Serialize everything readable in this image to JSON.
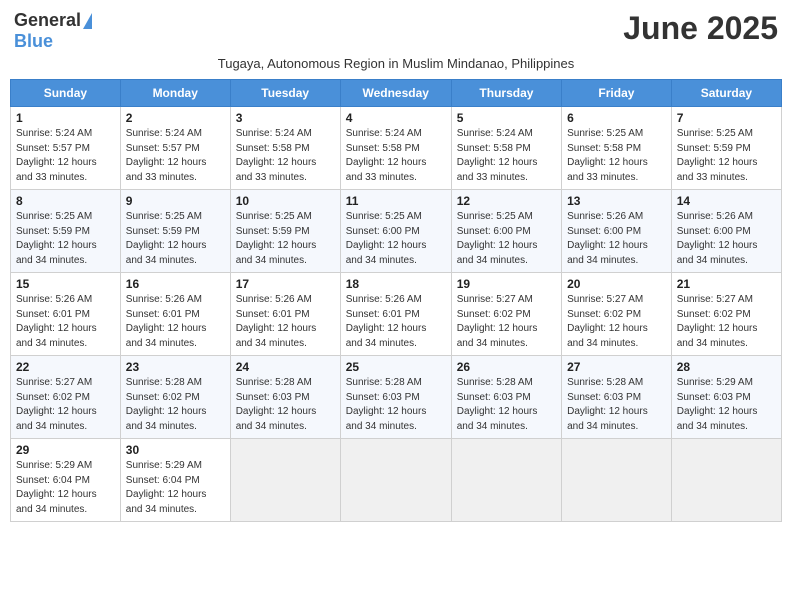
{
  "logo": {
    "general": "General",
    "blue": "Blue"
  },
  "title": "June 2025",
  "subtitle": "Tugaya, Autonomous Region in Muslim Mindanao, Philippines",
  "days_of_week": [
    "Sunday",
    "Monday",
    "Tuesday",
    "Wednesday",
    "Thursday",
    "Friday",
    "Saturday"
  ],
  "weeks": [
    [
      {
        "day": "1",
        "info": "Sunrise: 5:24 AM\nSunset: 5:57 PM\nDaylight: 12 hours\nand 33 minutes."
      },
      {
        "day": "2",
        "info": "Sunrise: 5:24 AM\nSunset: 5:57 PM\nDaylight: 12 hours\nand 33 minutes."
      },
      {
        "day": "3",
        "info": "Sunrise: 5:24 AM\nSunset: 5:58 PM\nDaylight: 12 hours\nand 33 minutes."
      },
      {
        "day": "4",
        "info": "Sunrise: 5:24 AM\nSunset: 5:58 PM\nDaylight: 12 hours\nand 33 minutes."
      },
      {
        "day": "5",
        "info": "Sunrise: 5:24 AM\nSunset: 5:58 PM\nDaylight: 12 hours\nand 33 minutes."
      },
      {
        "day": "6",
        "info": "Sunrise: 5:25 AM\nSunset: 5:58 PM\nDaylight: 12 hours\nand 33 minutes."
      },
      {
        "day": "7",
        "info": "Sunrise: 5:25 AM\nSunset: 5:59 PM\nDaylight: 12 hours\nand 33 minutes."
      }
    ],
    [
      {
        "day": "8",
        "info": "Sunrise: 5:25 AM\nSunset: 5:59 PM\nDaylight: 12 hours\nand 34 minutes."
      },
      {
        "day": "9",
        "info": "Sunrise: 5:25 AM\nSunset: 5:59 PM\nDaylight: 12 hours\nand 34 minutes."
      },
      {
        "day": "10",
        "info": "Sunrise: 5:25 AM\nSunset: 5:59 PM\nDaylight: 12 hours\nand 34 minutes."
      },
      {
        "day": "11",
        "info": "Sunrise: 5:25 AM\nSunset: 6:00 PM\nDaylight: 12 hours\nand 34 minutes."
      },
      {
        "day": "12",
        "info": "Sunrise: 5:25 AM\nSunset: 6:00 PM\nDaylight: 12 hours\nand 34 minutes."
      },
      {
        "day": "13",
        "info": "Sunrise: 5:26 AM\nSunset: 6:00 PM\nDaylight: 12 hours\nand 34 minutes."
      },
      {
        "day": "14",
        "info": "Sunrise: 5:26 AM\nSunset: 6:00 PM\nDaylight: 12 hours\nand 34 minutes."
      }
    ],
    [
      {
        "day": "15",
        "info": "Sunrise: 5:26 AM\nSunset: 6:01 PM\nDaylight: 12 hours\nand 34 minutes."
      },
      {
        "day": "16",
        "info": "Sunrise: 5:26 AM\nSunset: 6:01 PM\nDaylight: 12 hours\nand 34 minutes."
      },
      {
        "day": "17",
        "info": "Sunrise: 5:26 AM\nSunset: 6:01 PM\nDaylight: 12 hours\nand 34 minutes."
      },
      {
        "day": "18",
        "info": "Sunrise: 5:26 AM\nSunset: 6:01 PM\nDaylight: 12 hours\nand 34 minutes."
      },
      {
        "day": "19",
        "info": "Sunrise: 5:27 AM\nSunset: 6:02 PM\nDaylight: 12 hours\nand 34 minutes."
      },
      {
        "day": "20",
        "info": "Sunrise: 5:27 AM\nSunset: 6:02 PM\nDaylight: 12 hours\nand 34 minutes."
      },
      {
        "day": "21",
        "info": "Sunrise: 5:27 AM\nSunset: 6:02 PM\nDaylight: 12 hours\nand 34 minutes."
      }
    ],
    [
      {
        "day": "22",
        "info": "Sunrise: 5:27 AM\nSunset: 6:02 PM\nDaylight: 12 hours\nand 34 minutes."
      },
      {
        "day": "23",
        "info": "Sunrise: 5:28 AM\nSunset: 6:02 PM\nDaylight: 12 hours\nand 34 minutes."
      },
      {
        "day": "24",
        "info": "Sunrise: 5:28 AM\nSunset: 6:03 PM\nDaylight: 12 hours\nand 34 minutes."
      },
      {
        "day": "25",
        "info": "Sunrise: 5:28 AM\nSunset: 6:03 PM\nDaylight: 12 hours\nand 34 minutes."
      },
      {
        "day": "26",
        "info": "Sunrise: 5:28 AM\nSunset: 6:03 PM\nDaylight: 12 hours\nand 34 minutes."
      },
      {
        "day": "27",
        "info": "Sunrise: 5:28 AM\nSunset: 6:03 PM\nDaylight: 12 hours\nand 34 minutes."
      },
      {
        "day": "28",
        "info": "Sunrise: 5:29 AM\nSunset: 6:03 PM\nDaylight: 12 hours\nand 34 minutes."
      }
    ],
    [
      {
        "day": "29",
        "info": "Sunrise: 5:29 AM\nSunset: 6:04 PM\nDaylight: 12 hours\nand 34 minutes."
      },
      {
        "day": "30",
        "info": "Sunrise: 5:29 AM\nSunset: 6:04 PM\nDaylight: 12 hours\nand 34 minutes."
      },
      {
        "day": "",
        "info": ""
      },
      {
        "day": "",
        "info": ""
      },
      {
        "day": "",
        "info": ""
      },
      {
        "day": "",
        "info": ""
      },
      {
        "day": "",
        "info": ""
      }
    ]
  ]
}
